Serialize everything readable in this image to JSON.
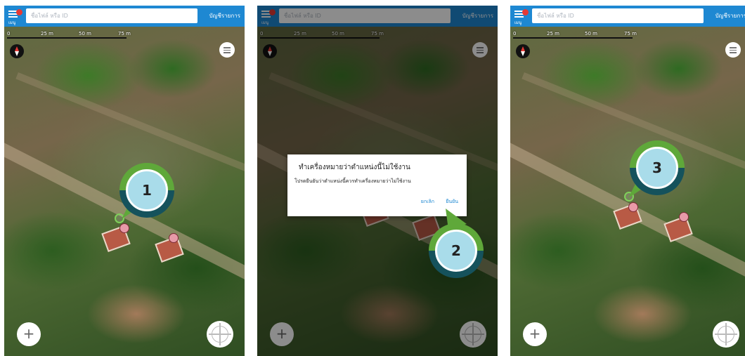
{
  "topbar": {
    "menu_label": "เมนู",
    "search_placeholder": "ชื่อไฟล์ หรือ ID",
    "account_label": "บัญชีรายการ"
  },
  "scale": {
    "labels": [
      "0",
      "25 m",
      "50 m",
      "75 m"
    ]
  },
  "dialog": {
    "title": "ทำเครื่องหมายว่าตำแหน่งนี้ไม่ใช้งาน",
    "message": "โปรดยืนยันว่าตำแหน่งนี้ควรทำเครื่องหมายว่าไม่ใช้งาน",
    "cancel_label": "ยกเลิก",
    "confirm_label": "ยืนยัน"
  },
  "buttons": {
    "add_label": "+"
  },
  "steps": [
    "1",
    "2",
    "3"
  ],
  "colors": {
    "topbar": "#1e88d2",
    "callout_top": "#5fa83a",
    "callout_bottom": "#15525c",
    "callout_fill": "#a9dcea"
  }
}
